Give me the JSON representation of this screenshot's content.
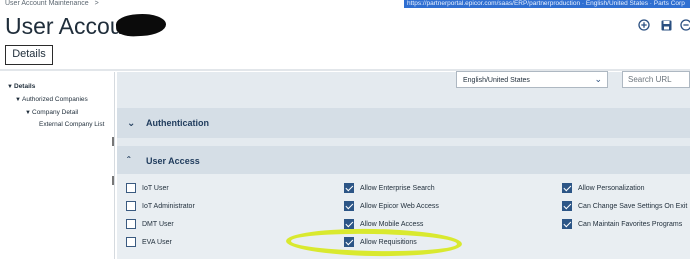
{
  "breadcrumb": {
    "text": "User Account Maintenance",
    "sep": ">"
  },
  "url_bar": {
    "text": "https://partnerportal.epicor.com/saas/ERP/partnerproduction  ·  English/United States  ·  Parts Corp"
  },
  "page": {
    "title": "User Account"
  },
  "header_icons": [
    "add-icon",
    "save-icon",
    "delete-icon"
  ],
  "tabs": [
    {
      "label": "Details"
    }
  ],
  "tree": {
    "items": [
      {
        "label": "Details",
        "expanded": true
      },
      {
        "label": "Authorized Companies",
        "expanded": true
      },
      {
        "label": "Company Detail",
        "expanded": true
      },
      {
        "label": "External Company List"
      }
    ]
  },
  "language": {
    "value": "English/United States"
  },
  "search": {
    "placeholder": "Search URL"
  },
  "sections": {
    "authentication": {
      "label": "Authentication",
      "expanded": false
    },
    "user_access": {
      "label": "User Access",
      "expanded": true
    }
  },
  "user_access": {
    "col1": [
      {
        "label": "IoT User",
        "checked": false
      },
      {
        "label": "IoT Administrator",
        "checked": false
      },
      {
        "label": "DMT User",
        "checked": false
      },
      {
        "label": "EVA User",
        "checked": false
      }
    ],
    "col2": [
      {
        "label": "Allow Enterprise Search",
        "checked": true
      },
      {
        "label": "Allow Epicor Web Access",
        "checked": true
      },
      {
        "label": "Allow Mobile Access",
        "checked": true
      },
      {
        "label": "Allow Requisitions",
        "checked": true
      }
    ],
    "col3": [
      {
        "label": "Allow Personalization",
        "checked": true
      },
      {
        "label": "Can Change Save Settings On Exit",
        "checked": true
      },
      {
        "label": "Can Maintain Favorites Programs",
        "checked": true
      }
    ]
  },
  "colors": {
    "accent": "#2c5586",
    "section_bg": "#d5dee6",
    "highlight": "#d7e81a"
  }
}
